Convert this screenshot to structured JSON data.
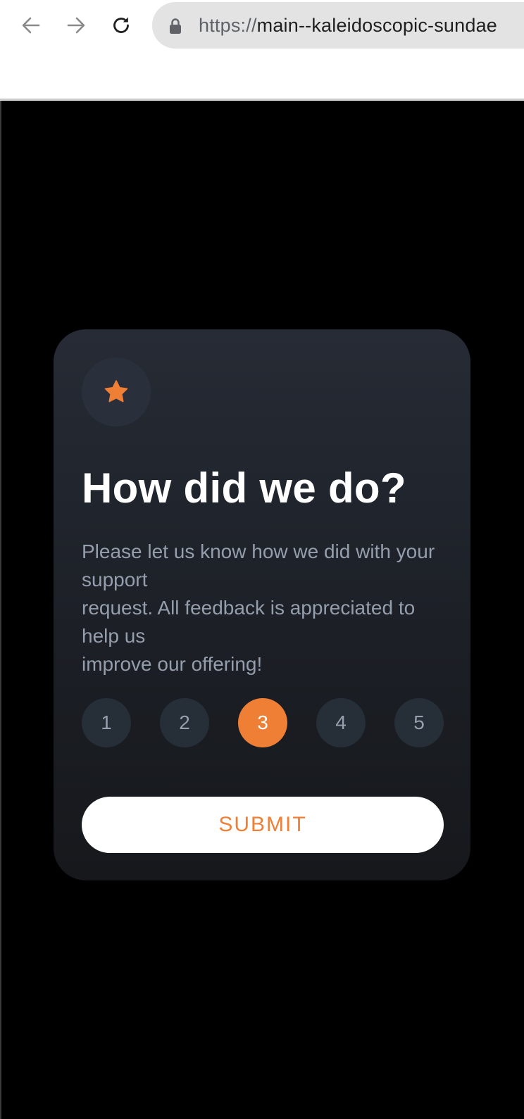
{
  "browser": {
    "url_scheme": "https://",
    "url_rest": "main--kaleidoscopic-sundae",
    "back_icon": "arrow-left-icon",
    "forward_icon": "arrow-right-icon",
    "reload_icon": "reload-icon",
    "lock_icon": "lock-icon"
  },
  "card": {
    "icon": "star-icon",
    "title": "How did we do?",
    "description_lines": [
      "Please let us know how we did with your support",
      "request. All feedback is appreciated to help us",
      "improve our offering!"
    ],
    "description": "Please let us know how we did with your support request. All feedback is appreciated to help us improve our offering!",
    "ratings": [
      "1",
      "2",
      "3",
      "4",
      "5"
    ],
    "selected_rating": "3",
    "submit_label": "SUBMIT"
  },
  "colors": {
    "accent": "#f07f36",
    "page_background": "#000000",
    "card_top": "#262b35",
    "card_bottom": "#16181c",
    "rating_background": "#262e38",
    "muted_text": "#959eac"
  }
}
